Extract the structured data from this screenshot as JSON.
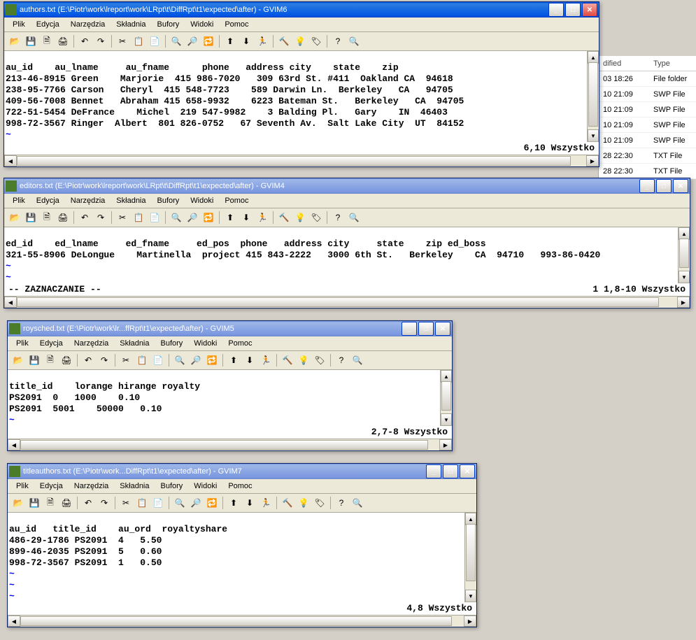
{
  "bg_panel": {
    "headers": [
      "dified",
      "Type"
    ],
    "rows": [
      [
        "03 18:26",
        "File folder"
      ],
      [
        "10 21:09",
        "SWP File"
      ],
      [
        "10 21:09",
        "SWP File"
      ],
      [
        "10 21:09",
        "SWP File"
      ],
      [
        "10 21:09",
        "SWP File"
      ],
      [
        "28 22:30",
        "TXT File"
      ],
      [
        "28 22:30",
        "TXT File"
      ]
    ]
  },
  "menus": [
    "Plik",
    "Edycja",
    "Narzędzia",
    "Składnia",
    "Bufory",
    "Widoki",
    "Pomoc"
  ],
  "toolbar_icons": [
    "open",
    "save",
    "saveall",
    "print",
    "|",
    "undo",
    "redo",
    "|",
    "cut",
    "copy",
    "paste",
    "|",
    "find1",
    "find2",
    "find3",
    "|",
    "up1",
    "down1",
    "jump",
    "|",
    "tool1",
    "tool2",
    "tool3",
    "|",
    "help",
    "about"
  ],
  "win1": {
    "title": "authors.txt (E:\\Piotr\\work\\lreport\\work\\LRpt\\t\\DiffRpt\\t1\\expected\\after) - GVIM6",
    "lines": [
      "au_id    au_lname     au_fname      phone   address city    state    zip",
      "213-46-8915 Green    Marjorie  415 986-7020   309 63rd St. #411  Oakland CA  94618",
      "238-95-7766 Carson   Cheryl  415 548-7723    589 Darwin Ln.  Berkeley   CA   94705",
      "409-56-7008 Bennet   Abraham 415 658-9932    6223 Bateman St.   Berkeley   CA  94705",
      "722-51-5454 DeFrance    Michel  219 547-9982    3 Balding Pl.   Gary    IN  46403",
      "998-72-3567 Ringer  Albert  801 826-0752   67 Seventh Av.  Salt Lake City  UT  84152"
    ],
    "status": "6,10         Wszystko"
  },
  "win2": {
    "title": "editors.txt (E:\\Piotr\\work\\lreport\\work\\LRpt\\t\\DiffRpt\\t1\\expected\\after) - GVIM4",
    "lines": [
      "ed_id    ed_lname     ed_fname     ed_pos  phone   address city     state    zip ed_boss",
      "321-55-8906 DeLongue    Martinella  project 415 843-2222   3000 6th St.   Berkeley    CA  94710   993-86-0420"
    ],
    "mode": "-- ZAZNACZANIE --",
    "status": "1           1,8-10    Wszystko"
  },
  "win3": {
    "title": "roysched.txt (E:\\Piotr\\work\\lr...ffRpt\\t1\\expected\\after) - GVIM5",
    "lines": [
      "title_id    lorange hirange royalty",
      "PS2091  0   1000    0.10",
      "PS2091  5001    50000   0.10"
    ],
    "status": "2,7-8       Wszystko"
  },
  "win4": {
    "title": "titleauthors.txt (E:\\Piotr\\work...DiffRpt\\t1\\expected\\after) - GVIM7",
    "lines": [
      "au_id   title_id    au_ord  royaltyshare",
      "486-29-1786 PS2091  4   5.50",
      "899-46-2035 PS2091  5   0.60",
      "998-72-3567 PS2091  1   0.50"
    ],
    "status": "4,8          Wszystko"
  }
}
